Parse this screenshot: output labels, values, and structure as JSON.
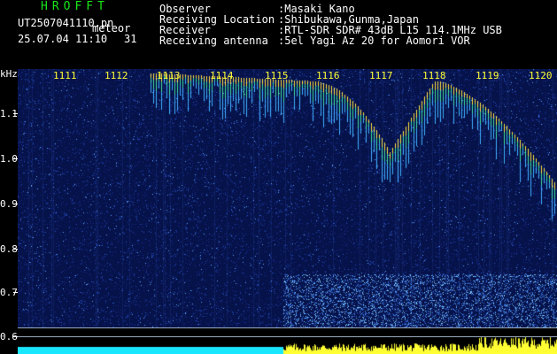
{
  "header": {
    "title": "HROFFT",
    "filename": "UT2507041110.pn",
    "meteor_label": "meteor",
    "datetime": "25.07.04 11:10",
    "count": "31",
    "fields": [
      {
        "label": "Observer",
        "value": ":Masaki Kano"
      },
      {
        "label": "Receiving Location",
        "value": ":Shibukawa,Gunma,Japan"
      },
      {
        "label": "Receiver",
        "value": ":RTL-SDR SDR# 43dB L15 114.1MHz USB"
      },
      {
        "label": "Receiving antenna",
        "value": ":5el Yagi Az 20 for Aomori VOR"
      }
    ]
  },
  "axis": {
    "unit": "kHz",
    "ticks": [
      "1.1",
      "1.0",
      "0.9",
      "0.8",
      "0.7",
      "0.6"
    ]
  },
  "time_labels": [
    "1111",
    "1112",
    "1113",
    "1114",
    "1115",
    "1116",
    "1117",
    "1118",
    "1119",
    "1120"
  ],
  "colors": {
    "title": "#19e619",
    "background": "#0a1a66",
    "marker": "#ffff33",
    "level": "#19e6ff"
  }
}
